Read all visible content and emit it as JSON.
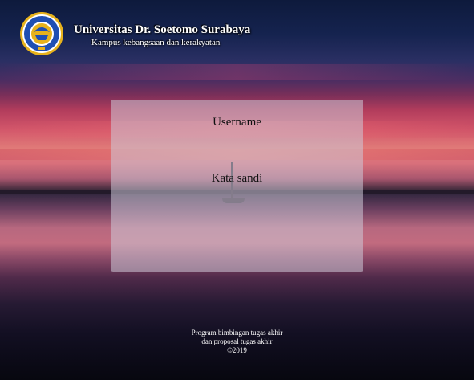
{
  "header": {
    "logo_icon": "university-seal-logo",
    "logo_text": "UNIVERSITAS DR. SOETOMO",
    "title": "Universitas Dr. Soetomo Surabaya",
    "subtitle": "Kampus kebangsaan dan kerakyatan"
  },
  "login": {
    "username_label": "Username",
    "username_value": "",
    "password_label": "Kata sandi",
    "password_value": ""
  },
  "footer": {
    "line1": "Program bimbingan tugas akhir",
    "line2": "dan proposal tugas akhir",
    "line3": "©2019"
  },
  "colors": {
    "panel": "#cdc8d7",
    "text_light": "#ffffff",
    "logo_blue": "#1f4fb3",
    "logo_gold": "#e7b21c"
  }
}
